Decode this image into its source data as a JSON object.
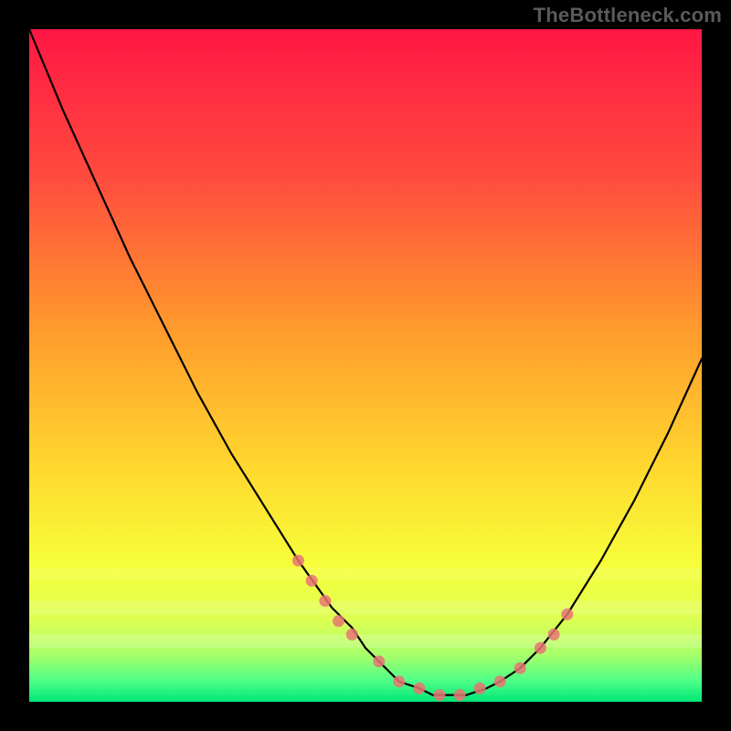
{
  "watermark": "TheBottleneck.com",
  "chart_data": {
    "type": "line",
    "title": "",
    "xlabel": "",
    "ylabel": "",
    "xlim": [
      0,
      100
    ],
    "ylim": [
      0,
      100
    ],
    "grid": false,
    "legend": false,
    "background_gradient": true,
    "gradient_stops": [
      {
        "offset": 0.0,
        "color": "#ff1744"
      },
      {
        "offset": 0.22,
        "color": "#ff4b3e"
      },
      {
        "offset": 0.45,
        "color": "#ff9c2d"
      },
      {
        "offset": 0.65,
        "color": "#ffd72e"
      },
      {
        "offset": 0.8,
        "color": "#f6ff3a"
      },
      {
        "offset": 0.88,
        "color": "#dcff53"
      },
      {
        "offset": 0.93,
        "color": "#a8ff6a"
      },
      {
        "offset": 0.97,
        "color": "#4bff88"
      },
      {
        "offset": 1.0,
        "color": "#00e676"
      }
    ],
    "series": [
      {
        "name": "curve",
        "color": "#000000",
        "x": [
          0,
          5,
          10,
          15,
          20,
          25,
          30,
          35,
          40,
          45,
          48,
          50,
          53,
          55,
          58,
          60,
          62,
          65,
          68,
          70,
          73,
          76,
          80,
          85,
          90,
          95,
          100
        ],
        "y": [
          100,
          88,
          77,
          66,
          56,
          46,
          37,
          29,
          21,
          14,
          11,
          8,
          5,
          3,
          2,
          1,
          1,
          1,
          2,
          3,
          5,
          8,
          13,
          21,
          30,
          40,
          51
        ]
      }
    ],
    "scatter": {
      "name": "markers",
      "color": "#e87472",
      "x": [
        40,
        42,
        44,
        46,
        48,
        52,
        55,
        58,
        61,
        64,
        67,
        70,
        73,
        76,
        78,
        80
      ],
      "y": [
        21,
        18,
        15,
        12,
        10,
        6,
        3,
        2,
        1,
        1,
        2,
        3,
        5,
        8,
        10,
        13
      ]
    }
  }
}
